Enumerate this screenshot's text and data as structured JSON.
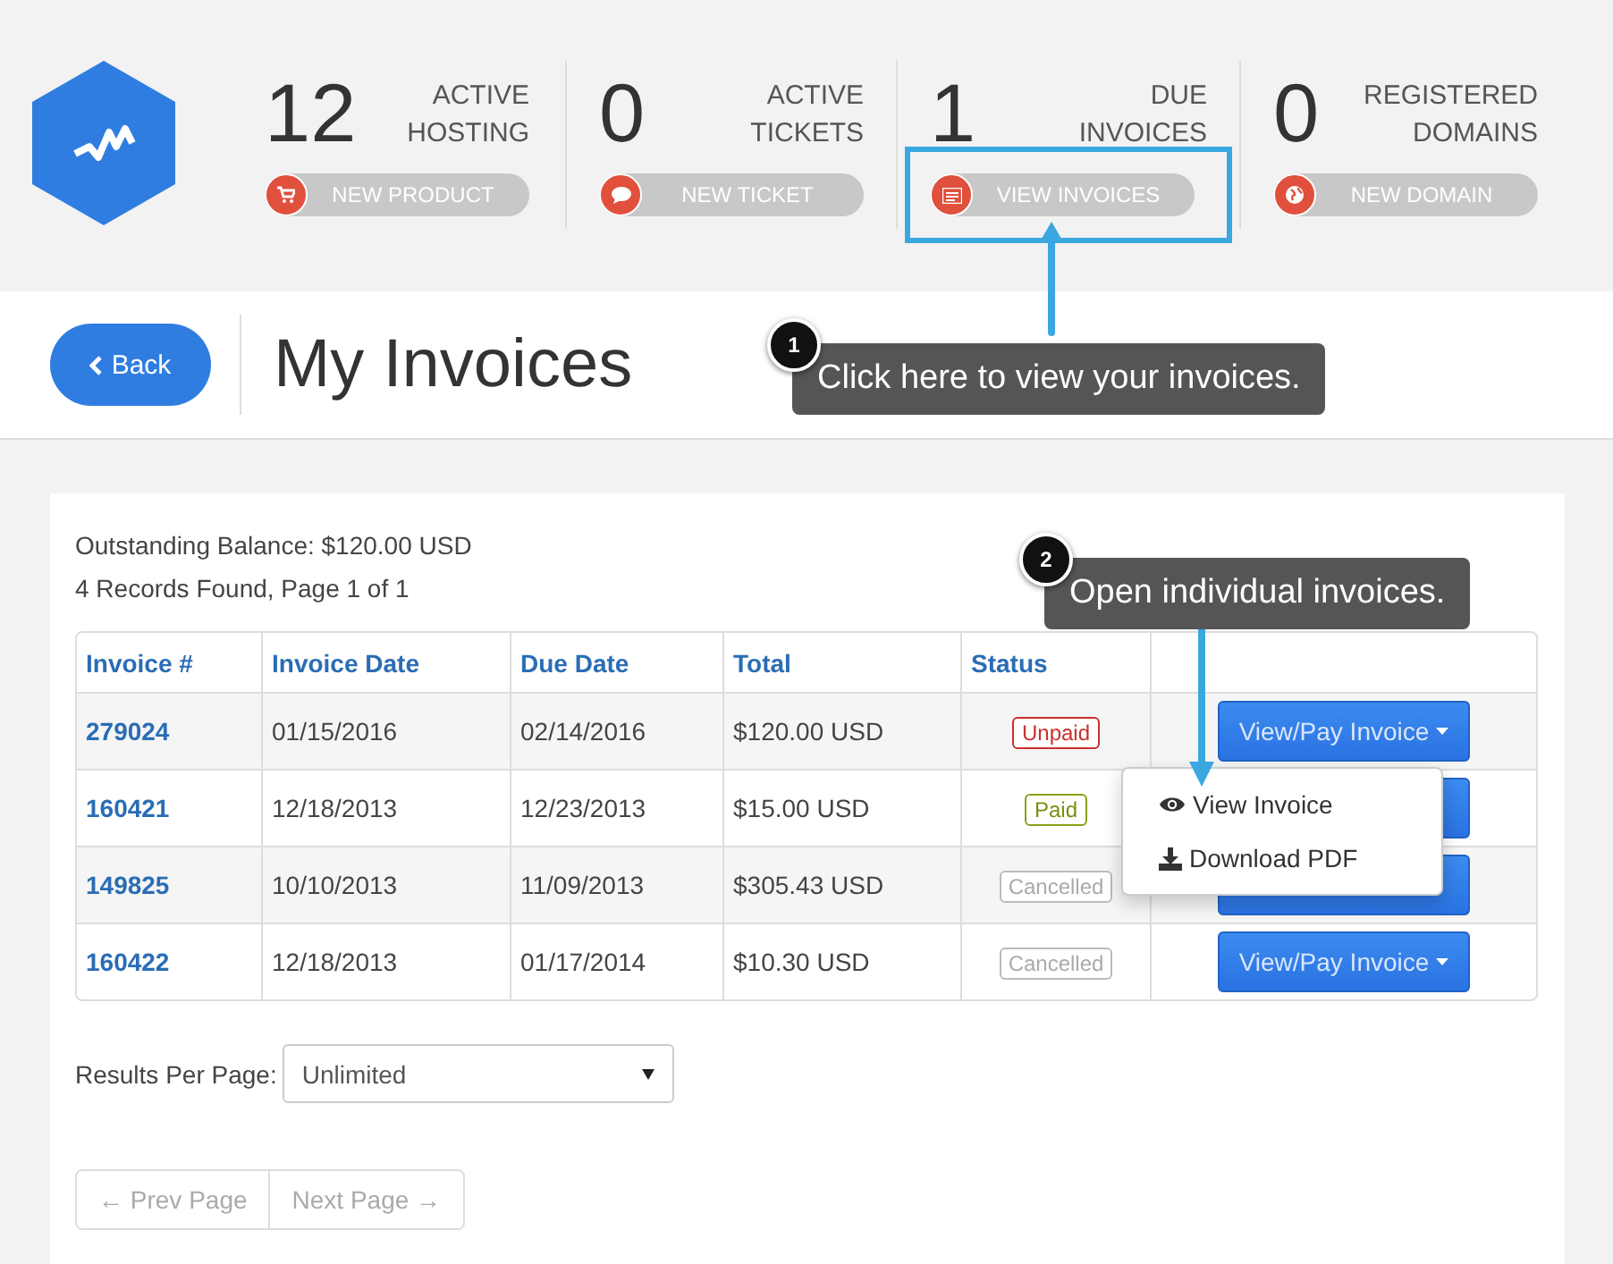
{
  "header": {
    "stats": [
      {
        "count": "12",
        "label": [
          "ACTIVE",
          "HOSTING"
        ],
        "button": "NEW PRODUCT",
        "highlighted": false
      },
      {
        "count": "0",
        "label": [
          "ACTIVE",
          "TICKETS"
        ],
        "button": "NEW TICKET",
        "highlighted": false
      },
      {
        "count": "1",
        "label": [
          "DUE",
          "INVOICES"
        ],
        "button": "VIEW INVOICES",
        "highlighted": true
      },
      {
        "count": "0",
        "label": [
          "REGISTERED",
          "DOMAINS"
        ],
        "button": "NEW DOMAIN",
        "highlighted": false
      }
    ]
  },
  "page": {
    "back_button": "Back",
    "title": "My Invoices"
  },
  "invoices": {
    "balance": "Outstanding Balance: $120.00 USD",
    "records": "4 Records Found, Page 1 of 1",
    "columns": [
      "Invoice #",
      "Invoice Date",
      "Due Date",
      "Total",
      "Status"
    ],
    "rows": [
      {
        "invoice": "279024",
        "invoice_date": "01/15/2016",
        "due_date": "02/14/2016",
        "total": "$120.00 USD",
        "status": "Unpaid",
        "kind": "unpaid",
        "action": "View/Pay Invoice"
      },
      {
        "invoice": "160421",
        "invoice_date": "12/18/2013",
        "due_date": "12/23/2013",
        "total": "$15.00 USD",
        "status": "Paid",
        "kind": "paid"
      },
      {
        "invoice": "149825",
        "invoice_date": "10/10/2013",
        "due_date": "11/09/2013",
        "total": "$305.43 USD",
        "status": "Cancelled",
        "kind": "cancelled"
      },
      {
        "invoice": "160422",
        "invoice_date": "12/18/2013",
        "due_date": "01/17/2014",
        "total": "$10.30 USD",
        "status": "Cancelled",
        "kind": "cancelled",
        "action": "View/Pay Invoice"
      }
    ],
    "dropdown": [
      {
        "label": "View Invoice"
      },
      {
        "label": "Download PDF"
      }
    ],
    "results_per_page": {
      "label": "Results Per Page:",
      "value": "Unlimited"
    },
    "pagination": [
      {
        "label": "← Prev Page",
        "disabled": true
      },
      {
        "label": "Next Page →",
        "disabled": true
      }
    ]
  },
  "annotations": [
    {
      "number": "1",
      "text": "Click here to view your invoices."
    },
    {
      "number": "2",
      "text": "Open individual invoices."
    }
  ]
}
